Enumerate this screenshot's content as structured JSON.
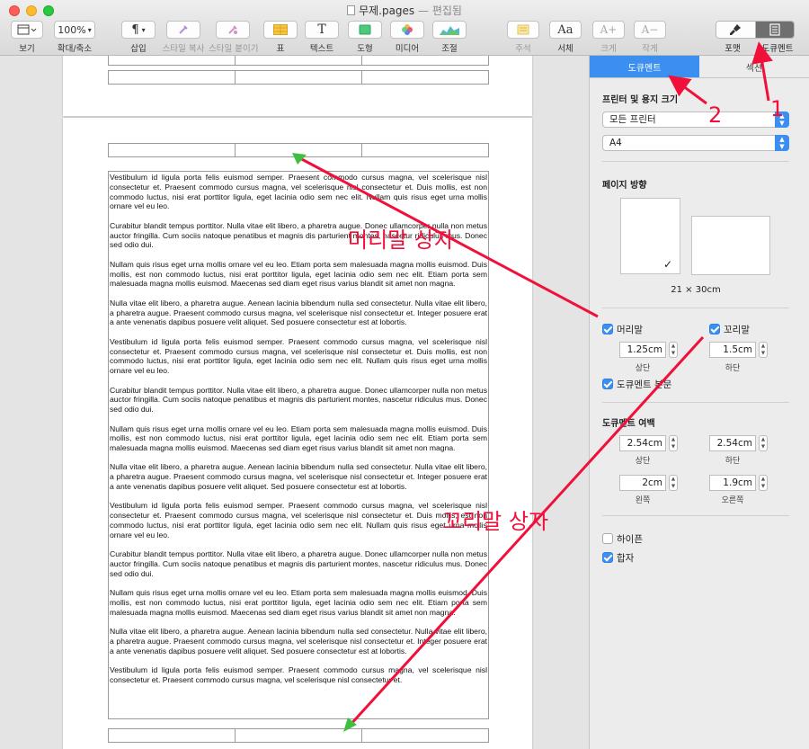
{
  "window": {
    "title": "무제.pages",
    "edited": " — 편집됨"
  },
  "toolbar": {
    "view_label": "보기",
    "zoom_value": "100%",
    "zoom_label": "확대/축소",
    "insert_label": "삽입",
    "copy_style_label": "스타일 복사",
    "paste_style_label": "스타일 붙이기",
    "table_label": "표",
    "text_label": "텍스트",
    "shape_label": "도형",
    "media_label": "미디어",
    "adjust_label": "조절",
    "comment_label": "주석",
    "font_label": "서체",
    "font_icon": "Aa",
    "bigger_label": "크게",
    "bigger_icon": "A+",
    "smaller_label": "작게",
    "smaller_icon": "A−",
    "format_label": "포맷",
    "document_label": "도큐멘트"
  },
  "inspector": {
    "tabs": [
      {
        "label": "도큐멘트"
      },
      {
        "label": "섹션"
      }
    ],
    "printer_title": "프린터 및 용지 크기",
    "printer_value": "모든 프린터",
    "paper_value": "A4",
    "orientation_title": "페이지 방향",
    "orientation_size": "21 × 30cm",
    "header_label": "머리말",
    "footer_label": "꼬리말",
    "header_value": "1.25cm",
    "footer_value": "1.5cm",
    "top_label": "상단",
    "bottom_label": "하단",
    "doc_body_label": "도큐멘트 본문",
    "margins_title": "도큐멘트 여백",
    "margin_top": "2.54cm",
    "margin_bottom": "2.54cm",
    "margin_left": "2cm",
    "margin_right": "1.9cm",
    "left_label": "왼쪽",
    "right_label": "오른쪽",
    "hyphen_label": "하이픈",
    "ligature_label": "합자"
  },
  "document": {
    "paragraphs": [
      "Vestibulum id ligula porta felis euismod semper. Praesent commodo cursus magna, vel scelerisque nisl consectetur et. Praesent commodo cursus magna, vel scelerisque nisl consectetur et. Duis mollis, est non commodo luctus, nisi erat porttitor ligula, eget lacinia odio sem nec elit. Nullam quis risus eget urna mollis ornare vel eu leo.",
      "Curabitur blandit tempus porttitor. Nulla vitae elit libero, a pharetra augue. Donec ullamcorper nulla non metus auctor fringilla. Cum sociis natoque penatibus et magnis dis parturient montes, nascetur ridiculus mus. Donec sed odio dui.",
      "Nullam quis risus eget urna mollis ornare vel eu leo. Etiam porta sem malesuada magna mollis euismod. Duis mollis, est non commodo luctus, nisi erat porttitor ligula, eget lacinia odio sem nec elit. Etiam porta sem malesuada magna mollis euismod. Maecenas sed diam eget risus varius blandit sit amet non magna.",
      "Nulla vitae elit libero, a pharetra augue. Aenean lacinia bibendum nulla sed consectetur. Nulla vitae elit libero, a pharetra augue. Praesent commodo cursus magna, vel scelerisque nisl consectetur et. Integer posuere erat a ante venenatis dapibus posuere velit aliquet. Sed posuere consectetur est at lobortis.",
      "Vestibulum id ligula porta felis euismod semper. Praesent commodo cursus magna, vel scelerisque nisl consectetur et. Praesent commodo cursus magna, vel scelerisque nisl consectetur et. Duis mollis, est non commodo luctus, nisi erat porttitor ligula, eget lacinia odio sem nec elit. Nullam quis risus eget urna mollis ornare vel eu leo.",
      "Curabitur blandit tempus porttitor. Nulla vitae elit libero, a pharetra augue. Donec ullamcorper nulla non metus auctor fringilla. Cum sociis natoque penatibus et magnis dis parturient montes, nascetur ridiculus mus. Donec sed odio dui.",
      "Nullam quis risus eget urna mollis ornare vel eu leo. Etiam porta sem malesuada magna mollis euismod. Duis mollis, est non commodo luctus, nisi erat porttitor ligula, eget lacinia odio sem nec elit. Etiam porta sem malesuada magna mollis euismod. Maecenas sed diam eget risus varius blandit sit amet non magna.",
      "Nulla vitae elit libero, a pharetra augue. Aenean lacinia bibendum nulla sed consectetur. Nulla vitae elit libero, a pharetra augue. Praesent commodo cursus magna, vel scelerisque nisl consectetur et. Integer posuere erat a ante venenatis dapibus posuere velit aliquet. Sed posuere consectetur est at lobortis.",
      "Vestibulum id ligula porta felis euismod semper. Praesent commodo cursus magna, vel scelerisque nisl consectetur et. Praesent commodo cursus magna, vel scelerisque nisl consectetur et. Duis mollis, est non commodo luctus, nisi erat porttitor ligula, eget lacinia odio sem nec elit. Nullam quis risus eget urna mollis ornare vel eu leo.",
      "Curabitur blandit tempus porttitor. Nulla vitae elit libero, a pharetra augue. Donec ullamcorper nulla non metus auctor fringilla. Cum sociis natoque penatibus et magnis dis parturient montes, nascetur ridiculus mus. Donec sed odio dui.",
      "Nullam quis risus eget urna mollis ornare vel eu leo. Etiam porta sem malesuada magna mollis euismod. Duis mollis, est non commodo luctus, nisi erat porttitor ligula, eget lacinia odio sem nec elit. Etiam porta sem malesuada magna mollis euismod. Maecenas sed diam eget risus varius blandit sit amet non magna.",
      "Nulla vitae elit libero, a pharetra augue. Aenean lacinia bibendum nulla sed consectetur. Nulla vitae elit libero, a pharetra augue. Praesent commodo cursus magna, vel scelerisque nisl consectetur et. Integer posuere erat a ante venenatis dapibus posuere velit aliquet. Sed posuere consectetur est at lobortis.",
      "Vestibulum id ligula porta felis euismod semper. Praesent commodo cursus magna, vel scelerisque nisl consectetur et. Praesent commodo cursus magna, vel scelerisque nisl consectetur et."
    ]
  },
  "annotations": {
    "header_box": "머리말 상자",
    "footer_box": "꼬리말 상자",
    "step1": "1",
    "step2": "2",
    "color": "#f0103a",
    "marker_color": "#3fbf3f"
  },
  "colors": {
    "accent": "#3b8ff0",
    "annotation": "#f0103a"
  }
}
